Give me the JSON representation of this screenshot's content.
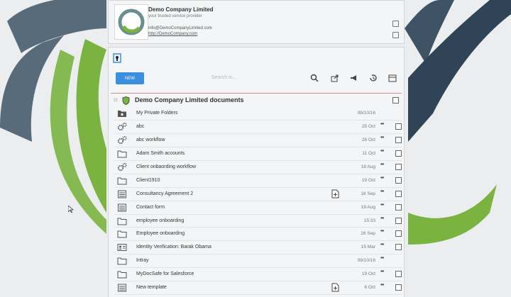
{
  "company": {
    "name": "Demo Company Limited",
    "tagline": "your trusted service provider",
    "email": "info@DemoCompanyLimited.com",
    "url": "http://DemoCompany.com"
  },
  "toolbar": {
    "new_label": "NEW",
    "search_placeholder": "Search in..."
  },
  "folder": {
    "title": "Demo Company Limited documents"
  },
  "items": [
    {
      "icon": "folder-lock-icon",
      "name": "My Private Folders",
      "date": "09/10/16",
      "more": false,
      "check": false,
      "doc": false
    },
    {
      "icon": "gears-icon",
      "name": "abc",
      "date": "25 Oct",
      "more": true,
      "check": true,
      "doc": false
    },
    {
      "icon": "gears-icon",
      "name": "abc workflow",
      "date": "26 Oct",
      "more": true,
      "check": true,
      "doc": false
    },
    {
      "icon": "folder-icon",
      "name": "Adam Smith accounts",
      "date": "11 Oct",
      "more": true,
      "check": true,
      "doc": false
    },
    {
      "icon": "gears-icon",
      "name": "Client onbaording workflow",
      "date": "18 Aug",
      "more": true,
      "check": true,
      "doc": false
    },
    {
      "icon": "folder-icon",
      "name": "Client1910",
      "date": "19 Oct",
      "more": true,
      "check": true,
      "doc": false
    },
    {
      "icon": "form-icon",
      "name": "Consultancy Agreement 2",
      "date": "18 Sep",
      "more": true,
      "check": true,
      "doc": true
    },
    {
      "icon": "form-icon",
      "name": "Contact form",
      "date": "18 Aug",
      "more": true,
      "check": true,
      "doc": false
    },
    {
      "icon": "folder-icon",
      "name": "employee onboarding",
      "date": "15:33",
      "more": true,
      "check": true,
      "doc": false
    },
    {
      "icon": "folder-icon",
      "name": "Employee onboarding",
      "date": "26 Sep",
      "more": true,
      "check": true,
      "doc": false
    },
    {
      "icon": "id-card-icon",
      "name": "Identity Verification: Barak Obama",
      "date": "15 Mar",
      "more": true,
      "check": true,
      "doc": false
    },
    {
      "icon": "folder-icon",
      "name": "Intray",
      "date": "09/10/16",
      "more": true,
      "check": false,
      "doc": false
    },
    {
      "icon": "folder-icon",
      "name": "MyDocSafe for Salesforce",
      "date": "19 Oct",
      "more": true,
      "check": true,
      "doc": false
    },
    {
      "icon": "form-icon",
      "name": "New template",
      "date": "6 Oct",
      "more": true,
      "check": true,
      "doc": true
    }
  ],
  "colors": {
    "accent": "#3a8fe0",
    "brand_green": "#7ab340",
    "brand_dark": "#3e5466"
  }
}
